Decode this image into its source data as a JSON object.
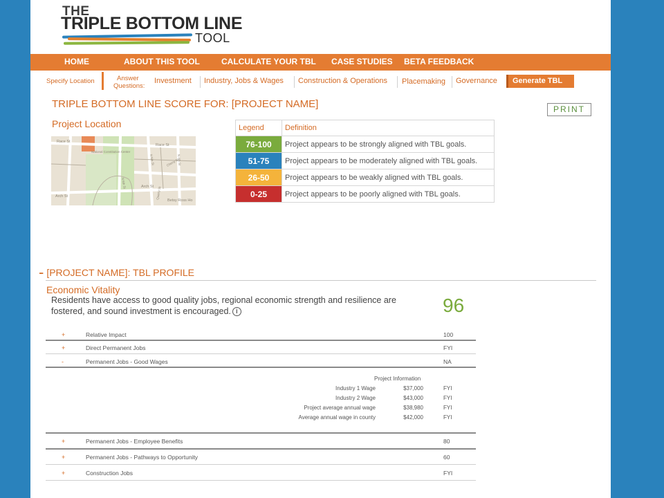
{
  "logo": {
    "the": "THE",
    "main": "TRIPLE BOTTOM LINE",
    "tool": "TOOL"
  },
  "main_nav": [
    "HOME",
    "ABOUT THIS TOOL",
    "CALCULATE YOUR TBL",
    "CASE STUDIES",
    "BETA FEEDBACK"
  ],
  "sub_nav": {
    "specify_location": "Specify Location",
    "answer_line1": "Answer",
    "answer_line2": "Questions:",
    "investment": "Investment",
    "industry": "Industry, Jobs & Wages",
    "construction": "Construction & Operations",
    "placemaking": "Placemaking",
    "governance": "Governance",
    "generate": "Generate TBL"
  },
  "title": "TRIPLE BOTTOM LINE SCORE FOR: [PROJECT NAME]",
  "print_label": "PRINT",
  "location_title": "Project Location",
  "map": {
    "streets": [
      "Race St",
      "Race St",
      "Arch St",
      "Arch St",
      "N 6th St",
      "N 5th St",
      "N 4th St",
      "Cherry St",
      "Quarry St",
      "Betsy Ross Ho",
      "National Constitution Center"
    ]
  },
  "legend": {
    "header_legend": "Legend",
    "header_definition": "Definition",
    "rows": [
      {
        "range": "76-100",
        "color": "#7aab3d",
        "definition": "Project appears to be strongly aligned with TBL goals."
      },
      {
        "range": "51-75",
        "color": "#2a82bc",
        "definition": "Project appears to be moderately aligned with TBL goals."
      },
      {
        "range": "26-50",
        "color": "#f4b33b",
        "definition": "Project appears to be weakly aligned with TBL goals."
      },
      {
        "range": "0-25",
        "color": "#c62f2e",
        "definition": "Project appears to be poorly aligned with TBL goals."
      }
    ]
  },
  "profile": {
    "dash": "-",
    "heading": "[PROJECT NAME]: TBL PROFILE",
    "section_title": "Economic Vitality",
    "description": "Residents have access to good quality jobs, regional economic strength and resilience are fostered, and sound investment is encouraged.",
    "info_icon": "i",
    "score": "96"
  },
  "metrics": [
    {
      "toggle": "+",
      "name": "Relative Impact",
      "value": "100"
    },
    {
      "toggle": "+",
      "name": "Direct Permanent Jobs",
      "value": "FYI"
    },
    {
      "toggle": "-",
      "name": "Permanent Jobs - Good Wages",
      "value": "NA"
    },
    {
      "toggle": "+",
      "name": "Permanent Jobs - Employee Benefits",
      "value": "80"
    },
    {
      "toggle": "+",
      "name": "Permanent Jobs - Pathways to Opportunity",
      "value": "60"
    },
    {
      "toggle": "+",
      "name": "Construction Jobs",
      "value": "FYI"
    }
  ],
  "project_info": {
    "header": "Project Information",
    "rows": [
      {
        "label": "Industry 1 Wage",
        "amount": "$37,000",
        "fyi": "FYI"
      },
      {
        "label": "Industry 2 Wage",
        "amount": "$43,000",
        "fyi": "FYI"
      },
      {
        "label": "Project average annual wage",
        "amount": "$38,980",
        "fyi": "FYI"
      },
      {
        "label": "Average annual wage in county",
        "amount": "$42,000",
        "fyi": "FYI"
      }
    ]
  }
}
